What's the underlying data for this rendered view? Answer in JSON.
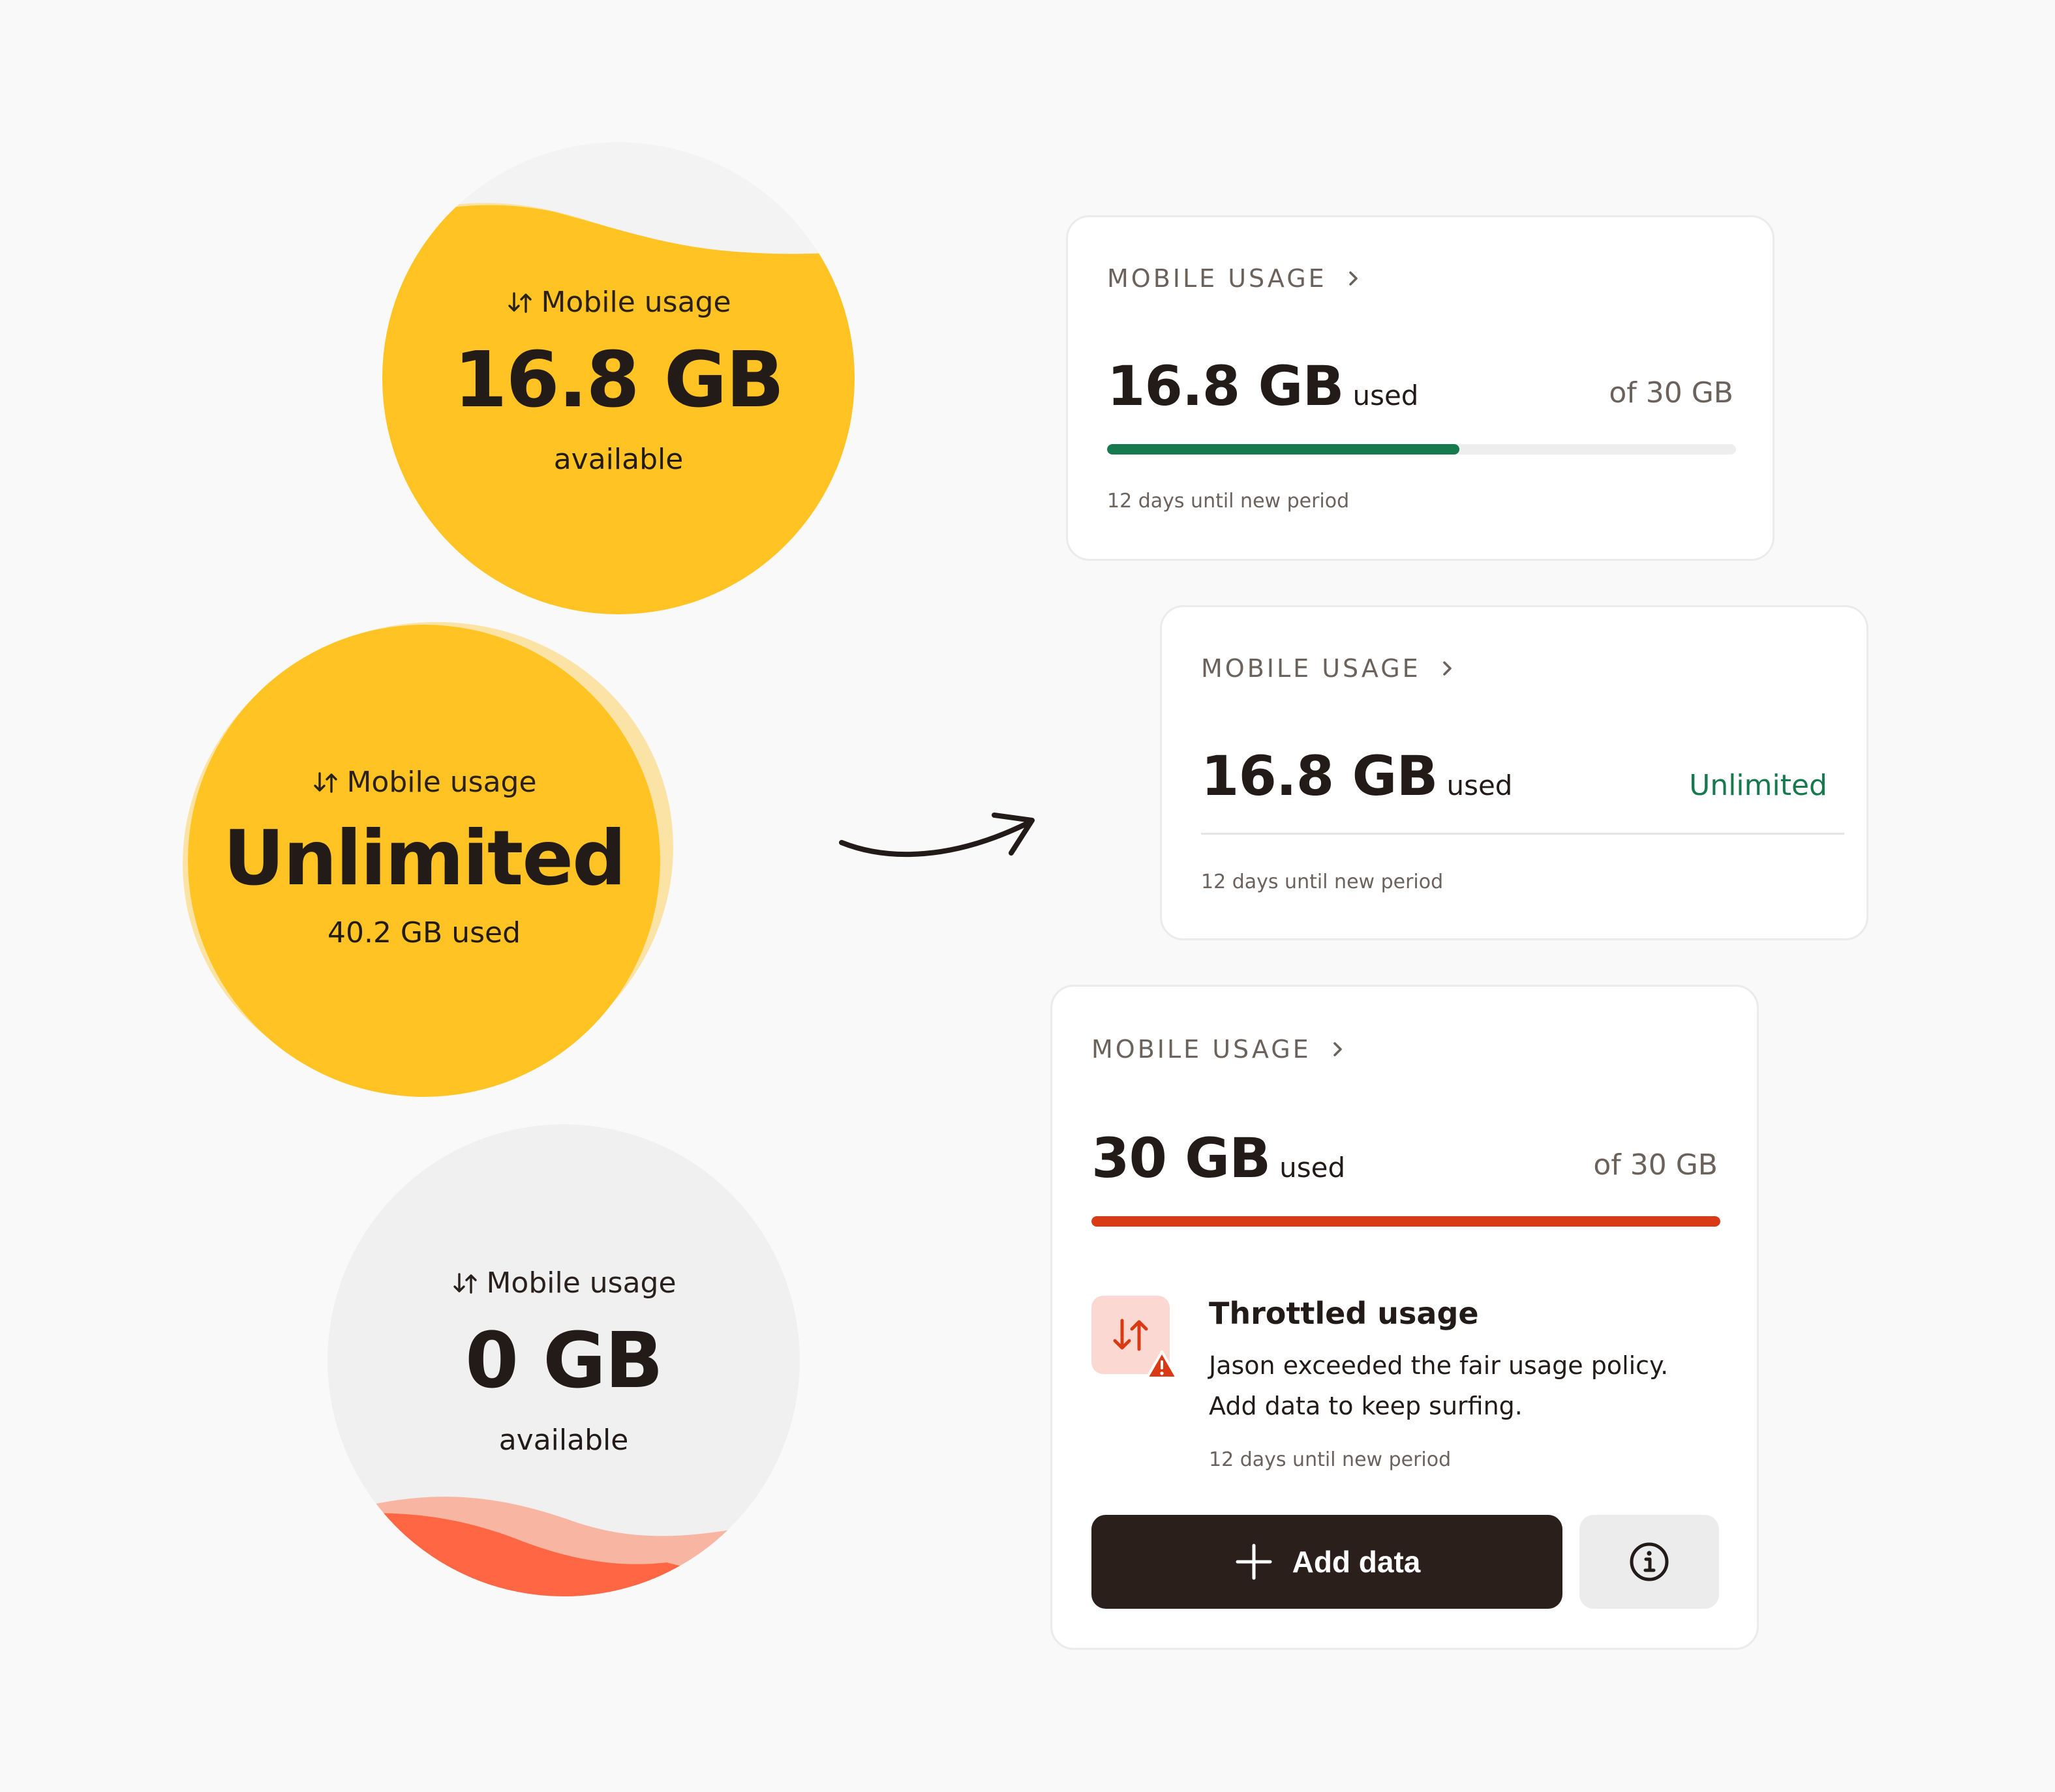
{
  "colors": {
    "yellow": "#ffc423",
    "yellow_light": "#fbe3a6",
    "grey_circle": "#f0f0f0",
    "orange": "#ff6643",
    "green": "#167a4e",
    "red": "#d93a14",
    "dark": "#2a1f1b"
  },
  "circles": [
    {
      "label": "Mobile usage",
      "value": "16.8 GB",
      "sub": "available",
      "icon": "arrows-up-down-icon",
      "fill_level": 0.56
    },
    {
      "label": "Mobile usage",
      "value": "Unlimited",
      "sub": "40.2 GB used",
      "icon": "arrows-up-down-icon"
    },
    {
      "label": "Mobile usage",
      "value": "0 GB",
      "sub": "available",
      "icon": "arrows-up-down-icon",
      "fill_level": 0.0
    }
  ],
  "cards": [
    {
      "header": "MOBILE USAGE",
      "used_value": "16.8 GB",
      "used_label": "used",
      "right_text": "of 30 GB",
      "progress": 0.56,
      "period": "12 days until new period"
    },
    {
      "header": "MOBILE USAGE",
      "used_value": "16.8 GB",
      "used_label": "used",
      "right_text": "Unlimited",
      "period": "12 days until new period"
    },
    {
      "header": "MOBILE USAGE",
      "used_value": "30 GB",
      "used_label": "used",
      "right_text": "of 30 GB",
      "progress": 1.0,
      "throttle_title": "Throttled usage",
      "throttle_text": "Jason exceeded the fair usage policy. Add data to keep surfing.",
      "period": "12 days until new period",
      "add_button": "Add data",
      "info_icon": "info-icon"
    }
  ]
}
